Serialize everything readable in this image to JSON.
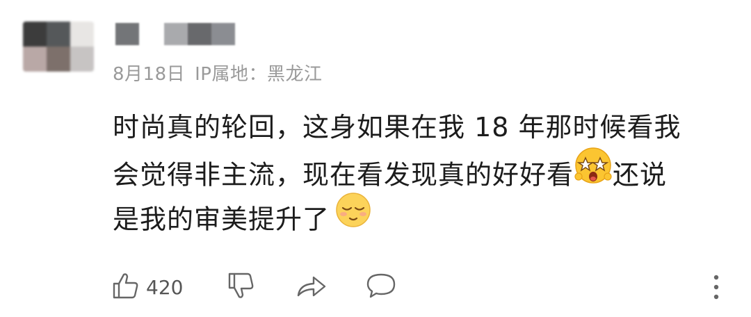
{
  "user": {
    "avatar_colors": [
      "#3c3c3c",
      "#55585a",
      "#e8e6e4",
      "#b9a8a6",
      "#7d706b",
      "#c7c4c3"
    ],
    "name_colors": [
      "#737578",
      "#ffffff",
      "#a9aaad",
      "#68696c",
      "#8b8d92"
    ]
  },
  "meta": {
    "date": "8月18日",
    "location": "IP属地：黑龙江"
  },
  "comment": {
    "lines": [
      "时尚真的轮回，这身如果在我 18 年那时候看我",
      "会觉得非主流，现在看发现真的好好看",
      "还说",
      "是我的审美提升了"
    ],
    "emojis": [
      "starstruck-emoji",
      "relieved-emoji"
    ]
  },
  "actions": {
    "like_count": "420",
    "icons": [
      "thumbs-up-icon",
      "thumbs-down-icon",
      "share-icon",
      "comment-icon",
      "more-icon"
    ],
    "icon_color": "#666666"
  }
}
